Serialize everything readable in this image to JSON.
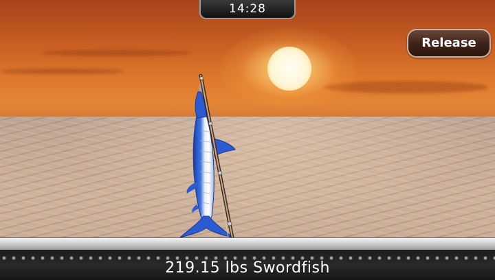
{
  "hud": {
    "timer": "14:28",
    "release_label": "Release"
  },
  "catch": {
    "summary": "219.15 lbs Swordfish"
  },
  "colors": {
    "sky_top": "#a8431a",
    "sky_bottom": "#e88a3a",
    "sun": "#fff6d8",
    "water": "#c7ac97",
    "button_bg": "#3f2418",
    "button_border": "#c9b3a6",
    "fish_blue": "#2a5bd0",
    "bar_bg": "#1c1c1c"
  },
  "icons": {
    "fish": "swordfish-icon",
    "rod": "fishing-rod-icon"
  }
}
